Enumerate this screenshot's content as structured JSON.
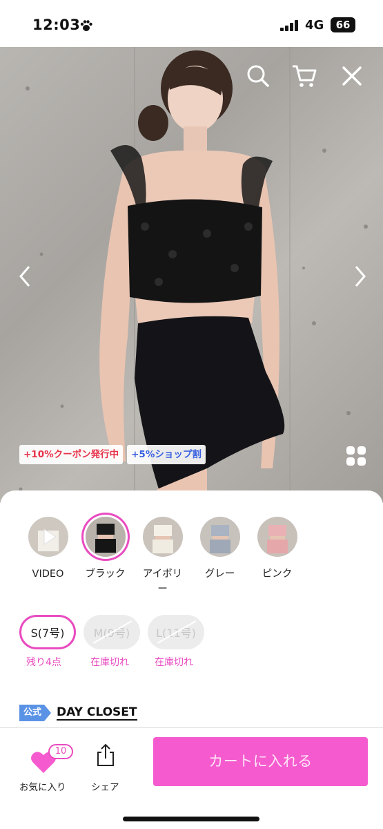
{
  "status_bar": {
    "time": "12:03",
    "network": "4G",
    "battery": "66"
  },
  "hero": {
    "icons": [
      "search-icon",
      "cart-icon",
      "close-icon",
      "chevron-left-icon",
      "chevron-right-icon",
      "grid-icon"
    ],
    "badges": [
      {
        "text": "+10%クーポン発行中",
        "color": "#e8334a"
      },
      {
        "text": "+5%ショップ割",
        "color": "#3a62e0"
      }
    ]
  },
  "variants": [
    {
      "label": "VIDEO",
      "selected": false
    },
    {
      "label": "ブラック",
      "selected": true
    },
    {
      "label": "アイボリー",
      "selected": false
    },
    {
      "label": "グレー",
      "selected": false
    },
    {
      "label": "ピンク",
      "selected": false
    }
  ],
  "sizes": [
    {
      "label": "S(7号)",
      "note": "残り4点",
      "available": true
    },
    {
      "label": "M(9号)",
      "note": "在庫切れ",
      "available": false
    },
    {
      "label": "L(11号)",
      "note": "在庫切れ",
      "available": false
    }
  ],
  "shop": {
    "badge": "公式",
    "name": "DAY CLOSET"
  },
  "bottom_bar": {
    "favorite_label": "お気に入り",
    "favorite_count": "10",
    "share_label": "シェア",
    "cart_label": "カートに入れる"
  },
  "colors": {
    "accent": "#e94bc0",
    "cart_button": "#f55bcf",
    "official_badge": "#5a93e6"
  }
}
